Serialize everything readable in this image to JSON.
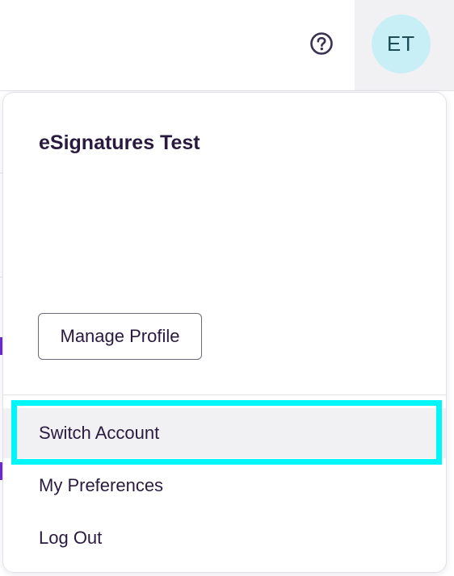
{
  "header": {
    "help_icon": "question-circle-icon",
    "avatar_initials": "ET"
  },
  "account_menu": {
    "account_name": "eSignatures Test",
    "manage_profile_label": "Manage Profile",
    "items": [
      {
        "label": "Switch Account",
        "highlighted": true
      },
      {
        "label": "My Preferences",
        "highlighted": false
      },
      {
        "label": "Log Out",
        "highlighted": false
      }
    ]
  },
  "colors": {
    "avatar_bg": "#c9eff6",
    "focus_ring": "#00f6f8",
    "text_primary": "#2a1a3f",
    "hover_bg": "#f1f1f4"
  }
}
